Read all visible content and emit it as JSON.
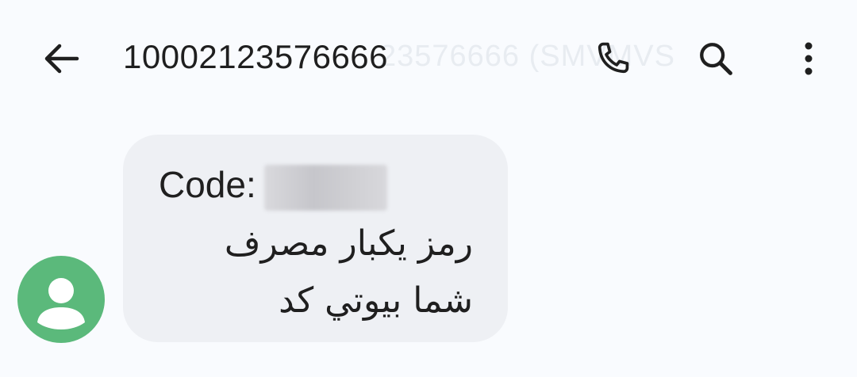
{
  "header": {
    "title": "10002123576666",
    "ghost_title": "23576666 (SMVMVS",
    "icons": {
      "back": "arrow-left-icon",
      "call": "phone-icon",
      "search": "search-icon",
      "more": "more-vertical-icon"
    }
  },
  "conversation": {
    "messages": [
      {
        "code_label": "Code:",
        "code_value_redacted": true,
        "body_text": "رمز يكبار مصرف شما بيوتي كد"
      }
    ],
    "avatar": {
      "icon": "person-icon",
      "color": "#5bb97b"
    }
  },
  "colors": {
    "background": "#f9fbfe",
    "bubble": "#eef0f4",
    "text": "#1f1f1f"
  }
}
